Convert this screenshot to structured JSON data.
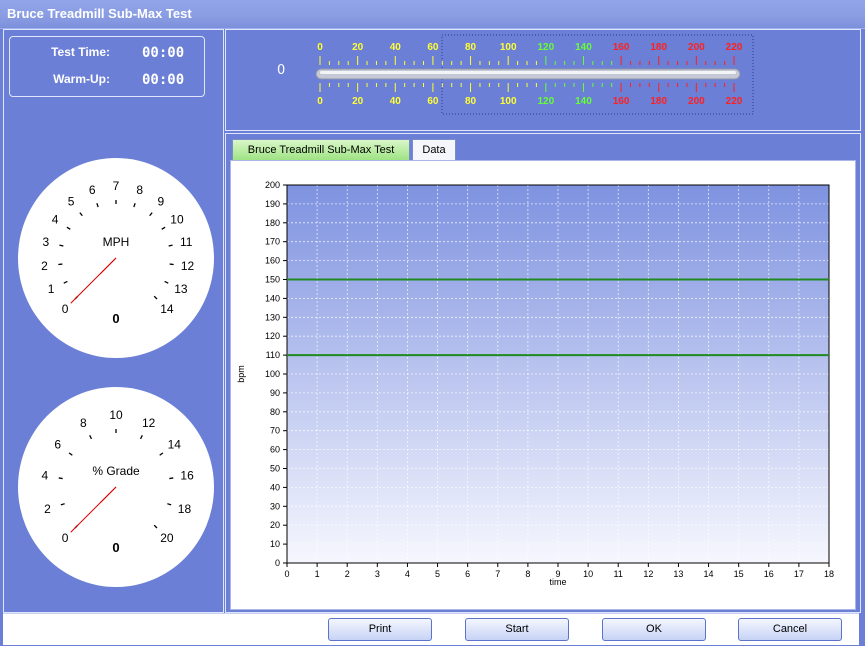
{
  "window": {
    "title": "Bruce Treadmill Sub-Max Test"
  },
  "timers": {
    "test_time_label": "Test Time:",
    "test_time_value": "00:00",
    "warmup_label": "Warm-Up:",
    "warmup_value": "00:00"
  },
  "speed_gauge": {
    "label": "MPH",
    "value": "0",
    "ticks": [
      "0",
      "1",
      "2",
      "3",
      "4",
      "5",
      "6",
      "7",
      "8",
      "9",
      "10",
      "11",
      "12",
      "13",
      "14"
    ],
    "min": 0,
    "max": 14
  },
  "grade_gauge": {
    "label": "% Grade",
    "value": "0",
    "ticks": [
      "0",
      "2",
      "4",
      "6",
      "8",
      "10",
      "12",
      "14",
      "16",
      "18",
      "20"
    ],
    "min": 0,
    "max": 20
  },
  "heart_rate": {
    "value": "0",
    "scale_labels": [
      "0",
      "20",
      "40",
      "60",
      "80",
      "100",
      "120",
      "140",
      "160",
      "180",
      "200",
      "220"
    ],
    "label_colors": [
      "#ffff33",
      "#ffff33",
      "#ffff33",
      "#ffff33",
      "#ffff33",
      "#ffff33",
      "#66ff33",
      "#66ff33",
      "#ff2020",
      "#ff2020",
      "#ff2020",
      "#ff2020"
    ]
  },
  "tabs": {
    "active_label": "Bruce Treadmill Sub-Max Test",
    "data_label": "Data"
  },
  "chart_data": {
    "type": "line",
    "xlabel": "time",
    "ylabel": "bpm",
    "xlim": [
      0,
      18
    ],
    "ylim": [
      0,
      200
    ],
    "x_ticks": [
      0,
      1,
      2,
      3,
      4,
      5,
      6,
      7,
      8,
      9,
      10,
      11,
      12,
      13,
      14,
      15,
      16,
      17,
      18
    ],
    "y_ticks": [
      0,
      10,
      20,
      30,
      40,
      50,
      60,
      70,
      80,
      90,
      100,
      110,
      120,
      130,
      140,
      150,
      160,
      170,
      180,
      190,
      200
    ],
    "grid": true,
    "series": [
      {
        "values": [
          [
            0,
            150
          ],
          [
            18,
            150
          ]
        ],
        "color": "#1f8a1f"
      },
      {
        "values": [
          [
            0,
            110
          ],
          [
            18,
            110
          ]
        ],
        "color": "#1f8a1f"
      }
    ]
  },
  "buttons": {
    "print": "Print",
    "start": "Start",
    "ok": "OK",
    "cancel": "Cancel"
  }
}
